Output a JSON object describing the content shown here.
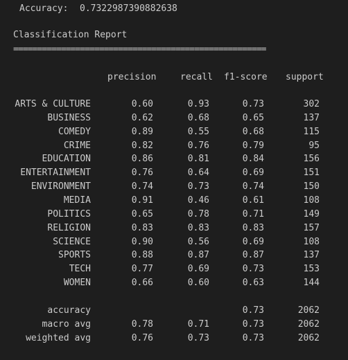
{
  "accuracy_line": {
    "label": "Accuracy:",
    "value": "0.7322987390882638"
  },
  "report": {
    "title": "Classification Report",
    "separator": "=====================================================",
    "headers": {
      "precision": "precision",
      "recall": "recall",
      "f1": "f1-score",
      "support": "support"
    },
    "rows": [
      {
        "label": "ARTS & CULTURE",
        "precision": "0.60",
        "recall": "0.93",
        "f1": "0.73",
        "support": "302"
      },
      {
        "label": "BUSINESS",
        "precision": "0.62",
        "recall": "0.68",
        "f1": "0.65",
        "support": "137"
      },
      {
        "label": "COMEDY",
        "precision": "0.89",
        "recall": "0.55",
        "f1": "0.68",
        "support": "115"
      },
      {
        "label": "CRIME",
        "precision": "0.82",
        "recall": "0.76",
        "f1": "0.79",
        "support": "95"
      },
      {
        "label": "EDUCATION",
        "precision": "0.86",
        "recall": "0.81",
        "f1": "0.84",
        "support": "156"
      },
      {
        "label": "ENTERTAINMENT",
        "precision": "0.76",
        "recall": "0.64",
        "f1": "0.69",
        "support": "151"
      },
      {
        "label": "ENVIRONMENT",
        "precision": "0.74",
        "recall": "0.73",
        "f1": "0.74",
        "support": "150"
      },
      {
        "label": "MEDIA",
        "precision": "0.91",
        "recall": "0.46",
        "f1": "0.61",
        "support": "108"
      },
      {
        "label": "POLITICS",
        "precision": "0.65",
        "recall": "0.78",
        "f1": "0.71",
        "support": "149"
      },
      {
        "label": "RELIGION",
        "precision": "0.83",
        "recall": "0.83",
        "f1": "0.83",
        "support": "157"
      },
      {
        "label": "SCIENCE",
        "precision": "0.90",
        "recall": "0.56",
        "f1": "0.69",
        "support": "108"
      },
      {
        "label": "SPORTS",
        "precision": "0.88",
        "recall": "0.87",
        "f1": "0.87",
        "support": "137"
      },
      {
        "label": "TECH",
        "precision": "0.77",
        "recall": "0.69",
        "f1": "0.73",
        "support": "153"
      },
      {
        "label": "WOMEN",
        "precision": "0.66",
        "recall": "0.60",
        "f1": "0.63",
        "support": "144"
      }
    ],
    "summary": [
      {
        "label": "accuracy",
        "precision": "",
        "recall": "",
        "f1": "0.73",
        "support": "2062"
      },
      {
        "label": "macro avg",
        "precision": "0.78",
        "recall": "0.71",
        "f1": "0.73",
        "support": "2062"
      },
      {
        "label": "weighted avg",
        "precision": "0.76",
        "recall": "0.73",
        "f1": "0.73",
        "support": "2062"
      }
    ]
  },
  "colors": {
    "background": "#1e1e1e",
    "text": "#cccccc"
  }
}
